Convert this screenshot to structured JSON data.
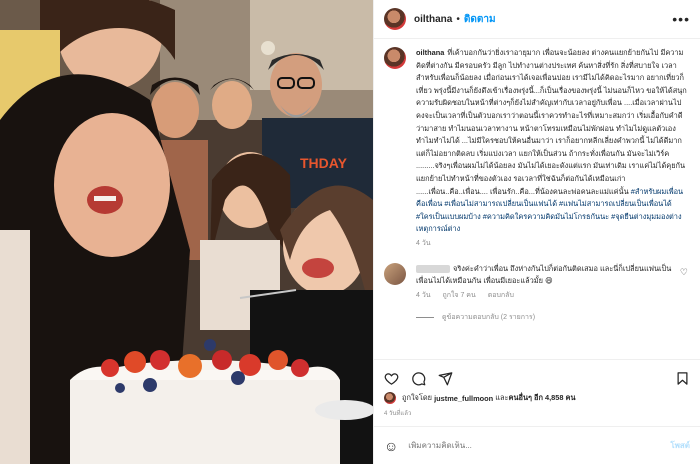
{
  "header": {
    "username": "oilthana",
    "separator": "•",
    "follow_label": "ติดตาม",
    "more_label": "•••"
  },
  "caption": {
    "username": "oilthana",
    "text": "ที่เค้าบอกกันว่ายิ่งเราอายุมาก เพื่อนจะน้อยลง ต่างคนแยกย้ายกันไป มีความคิดที่ต่างกัน มีครอบครัว มีลูก ไปทำงานต่างประเทศ ค้นหาสิ่งที่รัก สิ่งที่สบายใจ เวลาสำหรับเพื่อนก็น้อยลง เมื่อก่อนเราได้เจอเพื่อนบ่อย เรามีไม่ได้คิดอะไรมาก อยากเที่ยวก็เที่ยว พรุ่งนี้มีงานก็ยังดึงเข้าเรื่องพรุ่งนี้...ก็เป็นเรื่องของพรุ่งนี้ ไม่นอนก็ไหว ขอให้ได้สนุก ความรับผิดชอบในหน้าที่ต่างๆก็ยังไม่สำคัญเท่ากับเวลาอยู่กับเพื่อน ....เมื่อเวลาผ่านไป คงจะเป็นเวลาที่เป็นตัวบอกเราว่าตอนนี้เราควรทำอะไรที่เหมาะสมกว่า เริ่มเอื้อกับคำดี ว่ามาสาย ทำไมนอนเวลาทางาน หน้าตาโทรมเหมือนไม่พักผ่อน ทำไมไม่ดูแลตัวเอง ทำไมทำไม่ได้ ...ไม่มีใครชอบให้คนอื่นมาว่า เราก็อยากหลีกเลี่ยงคำพวกนี้ ไม่ได้ดีมาก แต่ก็ไม่อยากติดลบ เริ่มแบ่งเวลา แยกให้เป็นส่วน ถ้ากระทั่งเพื่อนกัน มันจะไม่เวิร์ค .........จริงๆเพื่อนผมไม่ได้น้อยลง มันไม่ได้เยอะดังแต่แรก มันเท่าเดิม เราแค่ไม่ได้คุยกัน แยกย้ายไปทำหน้าที่ของตัวเอง รอเวลาที่ใช่ฉันก็ต่อกันได้เหมือนเก่า ......เพื่อน..คือ..เพื่อน.... เพื่อนรัก..คือ...ที่น้องคนละพ่อคนละแม่แค่นั้น ",
    "hashtags": "#สำหรับผมเพื่อนคือเพื่อน #เพื่อนไม่สามารถเปลี่ยนเป็นแฟนได้ #แฟนไม่สามารถเปลี่ยนเป็นเพื่อนได้ #ใครเป็นแบบผมบ้าง #ความคิดใครความคิดมันไม่โกรธกันนะ #จุดยืนต่างมุมมองต่างเหตุการณ์ต่าง",
    "time": "4 วัน"
  },
  "comment": {
    "text": "จริงค่ะคำว่าเพื่อน ถึงห่างกันไปก็ต่อกันติดเสมอ และนี่ก็เปลี่ยนแฟนเป็นเพื่อนไม่ได้เหมือนกัน เพื่อนมีเยอะแล้วมั้ย 😄",
    "time": "4 วัน",
    "likes": "ถูกใจ 7 คน",
    "reply": "ตอบกลับ",
    "view_replies": "ดูข้อความตอบกลับ (2 รายการ)"
  },
  "likes": {
    "prefix": "ถูกใจโดย",
    "user": "justme_fullmoon",
    "connector": "และ",
    "others": "คนอื่นๆ อีก 4,858 คน"
  },
  "date": "4 วันที่แล้ว",
  "add_comment": {
    "placeholder": "เพิ่มความคิดเห็น...",
    "post_label": "โพสต์"
  },
  "icons": [
    "heart-icon",
    "comment-icon",
    "share-icon",
    "bookmark-icon",
    "emoji-icon"
  ],
  "colors": {
    "link": "#0095f6",
    "hashtag": "#00376b",
    "muted": "#8e8e8e"
  }
}
